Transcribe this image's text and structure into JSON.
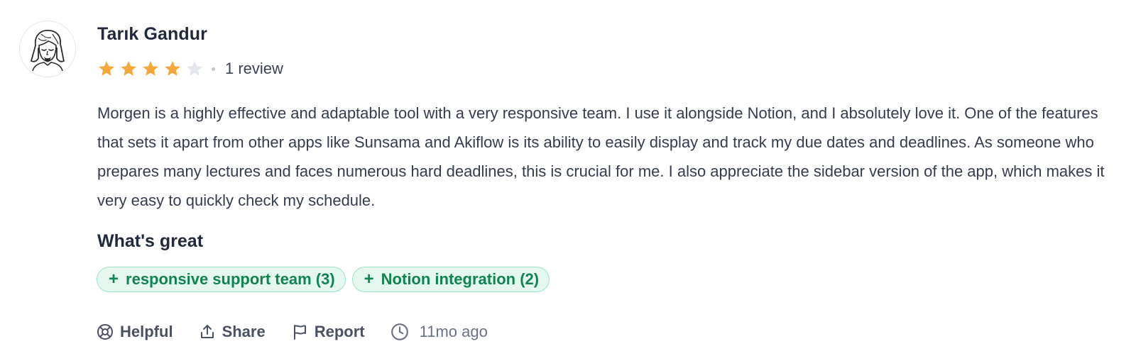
{
  "review": {
    "author": {
      "name": "Tarık Gandur",
      "avatar_icon": "illustrated-face-avatar"
    },
    "rating": {
      "value": 4,
      "max": 5,
      "filled_color": "#f6a83a",
      "empty_color": "#e3e6ec"
    },
    "review_count_label": "1 review",
    "body": "Morgen is a highly effective and adaptable tool with a very responsive team. I use it alongside Notion, and I absolutely love it. One of the features that sets it apart from other apps like Sunsama and Akiflow is its ability to easily display and track my due dates and deadlines. As someone who prepares many lectures and faces numerous hard deadlines, this is crucial for me. I also appreciate the sidebar version of the app, which makes it very easy to quickly check my schedule.",
    "whats_great": {
      "title": "What's great",
      "tags": [
        {
          "icon": "plus-icon",
          "label": "responsive support team (3)"
        },
        {
          "icon": "plus-icon",
          "label": "Notion integration (2)"
        }
      ],
      "tag_color": "#11834f"
    },
    "actions": {
      "helpful": {
        "icon": "lifebuoy-icon",
        "label": "Helpful"
      },
      "share": {
        "icon": "share-icon",
        "label": "Share"
      },
      "report": {
        "icon": "flag-icon",
        "label": "Report"
      },
      "timestamp": {
        "icon": "clock-icon",
        "label": "11mo ago"
      }
    }
  }
}
